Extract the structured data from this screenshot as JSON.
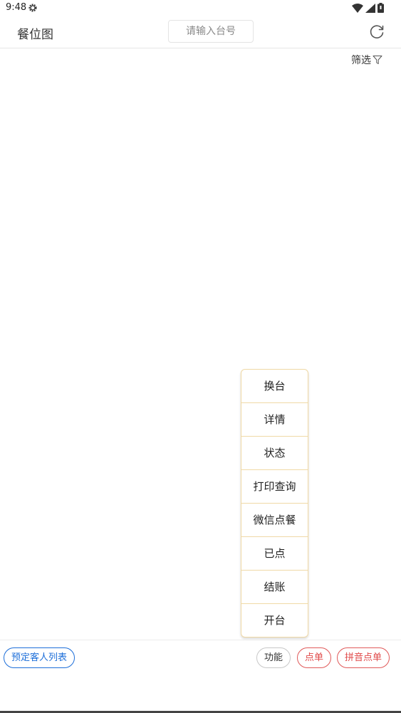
{
  "status_bar": {
    "time": "9:48",
    "icons": [
      "settings-icon",
      "wifi-icon",
      "signal-icon",
      "battery-icon"
    ]
  },
  "app_bar": {
    "title": "餐位图",
    "search_placeholder": "请输入台号",
    "search_value": "",
    "refresh_icon": "refresh-icon"
  },
  "filter": {
    "label": "筛选",
    "icon": "filter-icon"
  },
  "action_menu": {
    "items": [
      {
        "label": "换台"
      },
      {
        "label": "详情"
      },
      {
        "label": "状态"
      },
      {
        "label": "打印查询"
      },
      {
        "label": "微信点餐"
      },
      {
        "label": "已点"
      },
      {
        "label": "结账"
      },
      {
        "label": "开台"
      }
    ]
  },
  "bottom_bar": {
    "reservation_list": "预定客人列表",
    "functions": "功能",
    "order": "点单",
    "pinyin_order": "拼音点单"
  },
  "colors": {
    "menu_border": "#f0d9a6",
    "blue_accent": "#1e6fd9",
    "red_accent": "#e04848"
  }
}
